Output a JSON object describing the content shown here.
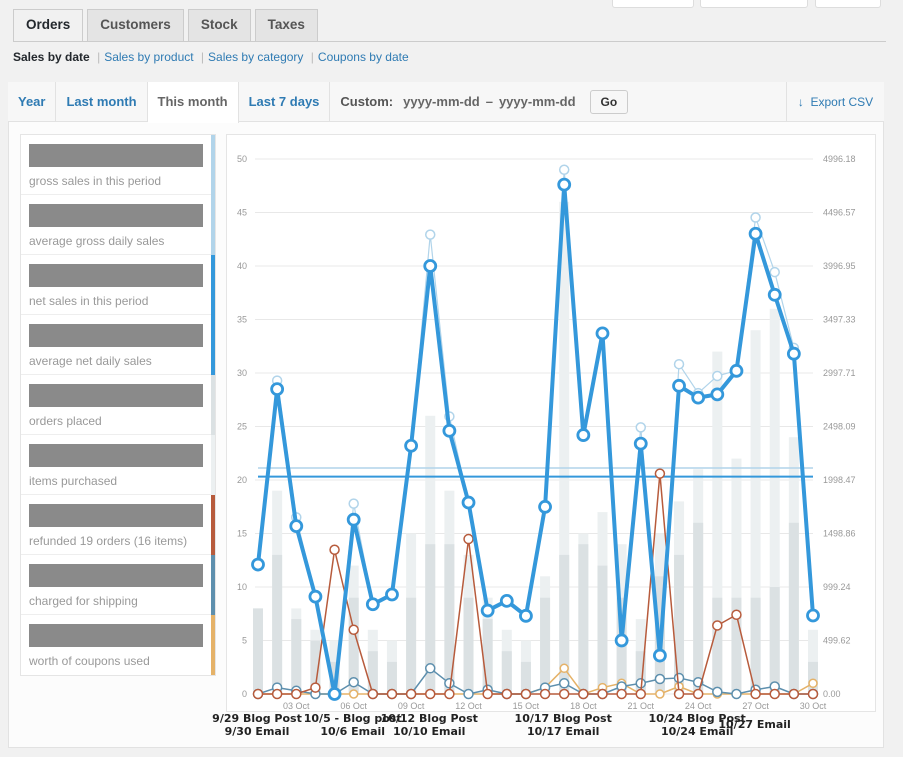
{
  "tabs": [
    {
      "label": "Orders",
      "active": true
    },
    {
      "label": "Customers",
      "active": false
    },
    {
      "label": "Stock",
      "active": false
    },
    {
      "label": "Taxes",
      "active": false
    }
  ],
  "subnav": {
    "current": "Sales by date",
    "links": [
      "Sales by product",
      "Sales by category",
      "Coupons by date"
    ]
  },
  "ranges": [
    {
      "label": "Year",
      "active": false
    },
    {
      "label": "Last month",
      "active": false
    },
    {
      "label": "This month",
      "active": true
    },
    {
      "label": "Last 7 days",
      "active": false
    }
  ],
  "custom": {
    "label": "Custom:",
    "from_placeholder": "yyyy-mm-dd",
    "dash": "–",
    "to_placeholder": "yyyy-mm-dd",
    "go_label": "Go"
  },
  "export": {
    "icon": "download-arrow-icon",
    "label": "Export CSV"
  },
  "legend": [
    {
      "label": "gross sales in this period",
      "color": "#b1d4ea"
    },
    {
      "label": "average gross daily sales",
      "color": "#b1d4ea"
    },
    {
      "label": "net sales in this period",
      "color": "#3498db"
    },
    {
      "label": "average net daily sales",
      "color": "#3498db"
    },
    {
      "label": "orders placed",
      "color": "#dbe1e3"
    },
    {
      "label": "items purchased",
      "color": "#ecf0f1"
    },
    {
      "label": "refunded 19 orders (16 items)",
      "color": "#b75b3c"
    },
    {
      "label": "charged for shipping",
      "color": "#5d8fad"
    },
    {
      "label": "worth of coupons used",
      "color": "#e5b268"
    }
  ],
  "chart_data": {
    "type": "line",
    "title": "",
    "xlabel": "",
    "ylabel": "",
    "x": [
      "01 Oct",
      "02 Oct",
      "03 Oct",
      "04 Oct",
      "05 Oct",
      "06 Oct",
      "07 Oct",
      "08 Oct",
      "09 Oct",
      "10 Oct",
      "11 Oct",
      "12 Oct",
      "13 Oct",
      "14 Oct",
      "15 Oct",
      "16 Oct",
      "17 Oct",
      "18 Oct",
      "19 Oct",
      "20 Oct",
      "21 Oct",
      "22 Oct",
      "23 Oct",
      "24 Oct",
      "25 Oct",
      "26 Oct",
      "27 Oct",
      "28 Oct",
      "29 Oct",
      "30 Oct"
    ],
    "x_tick_labels": [
      "03 Oct",
      "06 Oct",
      "09 Oct",
      "12 Oct",
      "15 Oct",
      "18 Oct",
      "21 Oct",
      "24 Oct",
      "27 Oct",
      "30 Oct"
    ],
    "y_left": {
      "range": [
        0,
        50
      ],
      "ticks": [
        "0",
        "5",
        "10",
        "15",
        "20",
        "25",
        "30",
        "35",
        "40",
        "45",
        "50"
      ]
    },
    "y_right": {
      "range": [
        0,
        4996.18
      ],
      "ticks": [
        "0.00",
        "499.62",
        "999.24",
        "1498.86",
        "1998.47",
        "2498.09",
        "2997.71",
        "3497.33",
        "3996.95",
        "4496.57",
        "4996.18"
      ]
    },
    "grid": true,
    "series": [
      {
        "name": "items purchased",
        "type": "bar",
        "color": "#ecf0f1",
        "values": [
          8,
          19,
          8,
          6,
          5,
          12,
          6,
          5,
          15,
          26,
          19,
          13,
          9,
          6,
          5,
          11,
          46,
          15,
          17,
          14,
          7,
          15,
          18,
          21,
          32,
          22,
          34,
          36,
          24,
          6
        ]
      },
      {
        "name": "orders placed",
        "type": "bar",
        "color": "#dbe1e3",
        "values": [
          8,
          13,
          7,
          5,
          3,
          9,
          4,
          3,
          9,
          14,
          14,
          9,
          7,
          4,
          3,
          9,
          13,
          14,
          12,
          9,
          4,
          11,
          13,
          16,
          9,
          9,
          9,
          10,
          16,
          3
        ]
      },
      {
        "name": "gross sales",
        "type": "line",
        "color": "#b1d4ea",
        "axis": "right",
        "values": [
          1211,
          2927,
          1650,
          911,
          0,
          1778,
          840,
          929,
          2322,
          4290,
          2592,
          1790,
          782,
          870,
          730,
          1750,
          4896,
          2420,
          3370,
          500,
          2490,
          359,
          3080,
          2810,
          2970,
          3020,
          4450,
          3940,
          3232,
          733
        ]
      },
      {
        "name": "net sales",
        "type": "line",
        "color": "#3498db",
        "axis": "right",
        "values": [
          1209,
          2847,
          1568,
          909,
          0,
          1628,
          838,
          929,
          2318,
          3997,
          2458,
          1788,
          779,
          870,
          730,
          1748,
          4757,
          2418,
          3368,
          500,
          2338,
          359,
          2878,
          2768,
          2798,
          3018,
          4298,
          3728,
          3178,
          733
        ]
      },
      {
        "name": "average gross daily sales",
        "type": "line",
        "color": "#b1d4ea",
        "axis": "right",
        "values": [
          2110
        ]
      },
      {
        "name": "average net daily sales",
        "type": "line",
        "color": "#3498db",
        "axis": "right",
        "values": [
          2030
        ]
      },
      {
        "name": "refunds",
        "type": "line",
        "color": "#b75b3c",
        "axis": "right",
        "values": [
          0,
          0,
          0,
          60,
          1347,
          600,
          0,
          0,
          0,
          0,
          0,
          1447,
          0,
          0,
          0,
          0,
          0,
          0,
          0,
          0,
          0,
          2058,
          0,
          0,
          640,
          740,
          0,
          0,
          0,
          0
        ]
      },
      {
        "name": "shipping",
        "type": "line",
        "color": "#5d8fad",
        "axis": "right",
        "values": [
          0,
          60,
          30,
          0,
          0,
          110,
          0,
          0,
          0,
          240,
          100,
          0,
          40,
          0,
          0,
          60,
          100,
          0,
          0,
          70,
          100,
          140,
          150,
          110,
          20,
          0,
          40,
          70,
          0,
          0
        ]
      },
      {
        "name": "coupons",
        "type": "line",
        "color": "#e5b268",
        "axis": "right",
        "values": [
          0,
          0,
          0,
          0,
          0,
          0,
          0,
          0,
          0,
          0,
          0,
          0,
          0,
          0,
          0,
          60,
          240,
          0,
          60,
          100,
          0,
          0,
          70,
          0,
          0,
          0,
          0,
          0,
          0,
          100
        ]
      }
    ],
    "annotations": [
      {
        "x": "01 Oct",
        "text": [
          "9/29 Blog Post",
          "9/30 Email"
        ]
      },
      {
        "x": "06 Oct",
        "text": [
          "10/5 - Blog post",
          "10/6 Email"
        ]
      },
      {
        "x": "10 Oct",
        "text": [
          "10/12 Blog Post",
          "10/10 Email"
        ]
      },
      {
        "x": "17 Oct",
        "text": [
          "10/17 Blog Post",
          "10/17 Email"
        ]
      },
      {
        "x": "24 Oct",
        "text": [
          "10/24 Blog Post",
          "10/24 Email"
        ]
      },
      {
        "x": "27 Oct",
        "text": [
          "10/27 Email"
        ]
      }
    ]
  }
}
